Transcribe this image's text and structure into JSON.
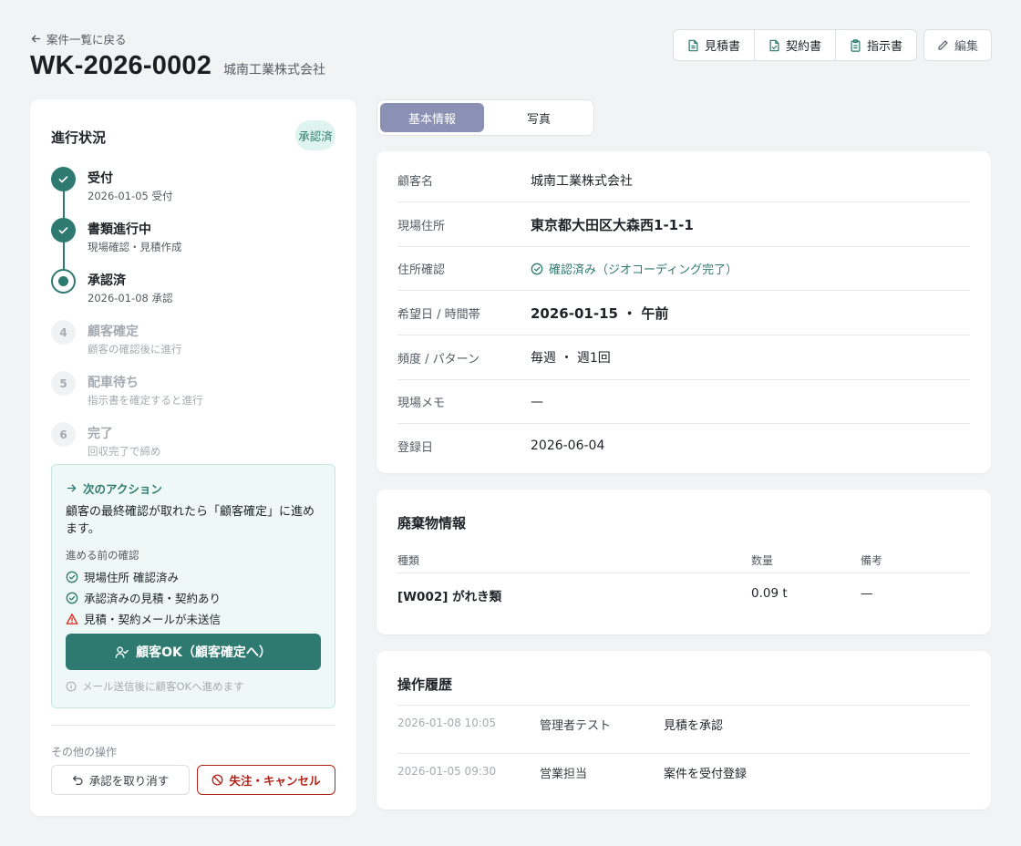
{
  "header": {
    "back_label": "案件一覧に戻る",
    "case_id": "WK-2026-0002",
    "company": "城南工業株式会社",
    "doc_buttons": [
      {
        "label": "見積書",
        "icon": "file-text-icon"
      },
      {
        "label": "契約書",
        "icon": "file-check-icon"
      },
      {
        "label": "指示書",
        "icon": "clipboard-icon"
      }
    ],
    "edit_label": "編集"
  },
  "progress": {
    "title": "進行状況",
    "status_badge": "承認済",
    "steps": [
      {
        "number": "1",
        "label": "受付",
        "sub": "2026-01-05 受付",
        "state": "done"
      },
      {
        "number": "2",
        "label": "書類進行中",
        "sub": "現場確認・見積作成",
        "state": "done"
      },
      {
        "number": "3",
        "label": "承認済",
        "sub": "2026-01-08 承認",
        "state": "current"
      },
      {
        "number": "4",
        "label": "顧客確定",
        "sub": "顧客の確認後に進行",
        "state": "pending"
      },
      {
        "number": "5",
        "label": "配車待ち",
        "sub": "指示書を確定すると進行",
        "state": "pending"
      },
      {
        "number": "6",
        "label": "完了",
        "sub": "回収完了で締め",
        "state": "pending"
      }
    ]
  },
  "next_action": {
    "title": "次のアクション",
    "description": "顧客の最終確認が取れたら「顧客確定」に進めます。",
    "checklist_title": "進める前の確認",
    "checklist": [
      {
        "label": "現場住所 確認済み",
        "status": "ok"
      },
      {
        "label": "承認済みの見積・契約あり",
        "status": "ok"
      },
      {
        "label": "見積・契約メールが未送信",
        "status": "warning"
      }
    ],
    "primary_button": "顧客OK（顧客確定へ）",
    "hint": "メール送信後に顧客OKへ進めます"
  },
  "other_actions": {
    "title": "その他の操作",
    "undo_label": "承認を取り消す",
    "cancel_label": "失注・キャンセル"
  },
  "tabs": [
    {
      "label": "基本情報",
      "active": true
    },
    {
      "label": "写真",
      "active": false
    }
  ],
  "basic_info": [
    {
      "label": "顧客名",
      "value": "城南工業株式会社"
    },
    {
      "label": "現場住所",
      "value": "東京都大田区大森西1-1-1"
    },
    {
      "label": "住所確認",
      "value": "確認済み（ジオコーディング完了）"
    },
    {
      "label": "希望日 / 時間帯",
      "value": "2026-01-15 ・ 午前"
    },
    {
      "label": "頻度 / パターン",
      "value": "毎週 ・ 週1回"
    },
    {
      "label": "現場メモ",
      "value": "—"
    },
    {
      "label": "登録日",
      "value": "2026-06-04"
    }
  ],
  "waste": {
    "title": "廃棄物情報",
    "columns": [
      "種類",
      "数量",
      "備考"
    ],
    "rows": [
      {
        "type": "[W002] がれき類",
        "quantity": "0.09 t",
        "note": "—"
      }
    ]
  },
  "history": {
    "title": "操作履歴",
    "rows": [
      {
        "timestamp": "2026-01-08 10:05",
        "user": "管理者テスト",
        "action": "見積を承認"
      },
      {
        "timestamp": "2026-01-05 09:30",
        "user": "営業担当",
        "action": "案件を受付登録"
      }
    ]
  },
  "colors": {
    "accent": "#2e7a70",
    "tab_active": "#8a91b5",
    "danger": "#b42318",
    "warning": "#d92d20"
  }
}
